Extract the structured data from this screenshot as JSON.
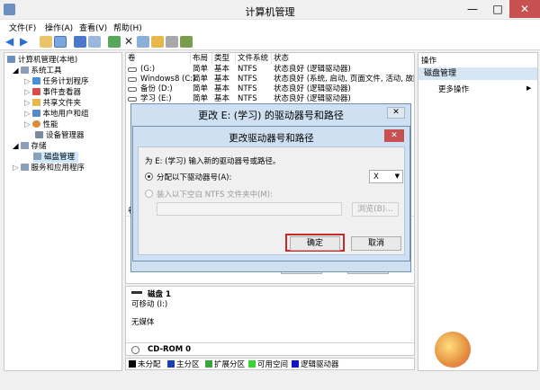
{
  "window": {
    "title": "计算机管理",
    "minimize_glyph": "—",
    "maximize_glyph": "□",
    "close_glyph": "✕"
  },
  "menu": [
    "文件(F)",
    "操作(A)",
    "查看(V)",
    "帮助(H)"
  ],
  "toolbar_icons": [
    "back-icon",
    "forward-icon",
    "folder-up-icon",
    "show-tree-icon",
    "help-icon",
    "properties-icon",
    "refresh-icon",
    "delete-icon",
    "properties-icon",
    "open-icon",
    "search-icon",
    "settings-icon"
  ],
  "tree": {
    "root": "计算机管理(本地)",
    "system_tools": "系统工具",
    "task_scheduler": "任务计划程序",
    "event_viewer": "事件查看器",
    "shared_folders": "共享文件夹",
    "local_users": "本地用户和组",
    "performance": "性能",
    "device_manager": "设备管理器",
    "storage": "存储",
    "disk_management": "磁盘管理",
    "services_apps": "服务和应用程序"
  },
  "volumes": {
    "headers": [
      "卷",
      "布局",
      "类型",
      "文件系统",
      "状态"
    ],
    "rows": [
      [
        "(G:)",
        "简单",
        "基本",
        "NTFS",
        "状态良好 (逻辑驱动器)"
      ],
      [
        "Windows8 (C:)",
        "简单",
        "基本",
        "NTFS",
        "状态良好 (系统, 启动, 页面文件, 活动, 故障"
      ],
      [
        "备份 (D:)",
        "简单",
        "基本",
        "NTFS",
        "状态良好 (逻辑驱动器)"
      ],
      [
        "学习 (E:)",
        "简单",
        "基本",
        "NTFS",
        "状态良好 (逻辑驱动器)"
      ]
    ],
    "lower_header": "卷",
    "ghost_ok": "确定",
    "ghost_cancel": "取消"
  },
  "disk": {
    "name": "磁盘 1",
    "type": "可移动 (I:)",
    "media": "无媒体",
    "cdrom": "CD-ROM 0"
  },
  "legend": [
    {
      "label": "未分配",
      "color": "#000000"
    },
    {
      "label": "主分区",
      "color": "#1a3fb0"
    },
    {
      "label": "扩展分区",
      "color": "#3aa53a"
    },
    {
      "label": "可用空间",
      "color": "#3ad43a"
    },
    {
      "label": "逻辑驱动器",
      "color": "#1515c8"
    }
  ],
  "actions": {
    "header": "操作",
    "section": "磁盘管理",
    "more": "更多操作",
    "more_arrow": "▶"
  },
  "outer_dialog": {
    "title": "更改 E: (学习) 的驱动器号和路径"
  },
  "inner_dialog": {
    "title": "更改驱动器号和路径",
    "prompt": "为 E: (学习) 输入新的驱动器号或路径。",
    "option_letter": "分配以下驱动器号(A):",
    "letter_value": "X",
    "option_folder": "装入以下空白 NTFS 文件夹中(M):",
    "browse": "浏览(B)...",
    "ok": "确定",
    "cancel": "取消"
  },
  "colors": {
    "highlight": "#c62828",
    "dialog_frame": "#cfe0f2",
    "selected_tree": "#cde8ff"
  }
}
